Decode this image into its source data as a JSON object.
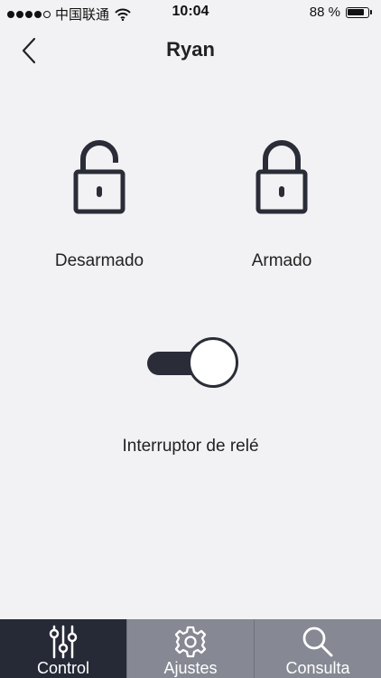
{
  "status_bar": {
    "carrier": "中国联通",
    "time": "10:04",
    "battery_percent": "88 %",
    "battery_level": 0.88,
    "signal_bars_filled": 4,
    "signal_bars_total": 5
  },
  "header": {
    "title": "Ryan",
    "back_icon": "chevron-left-icon"
  },
  "locks": {
    "disarmed_label": "Desarmado",
    "disarmed_icon": "unlocked-padlock-icon",
    "armed_label": "Armado",
    "armed_icon": "locked-padlock-icon"
  },
  "relay": {
    "label": "Interruptor de relé",
    "state": "on"
  },
  "tabs": [
    {
      "label": "Control",
      "icon": "sliders-icon",
      "active": true
    },
    {
      "label": "Ajustes",
      "icon": "gear-icon",
      "active": false
    },
    {
      "label": "Consulta",
      "icon": "search-icon",
      "active": false
    }
  ],
  "colors": {
    "background": "#f2f2f4",
    "icon_dark": "#2a2d38",
    "tab_active": "#262936",
    "tab_inactive": "#868893"
  }
}
